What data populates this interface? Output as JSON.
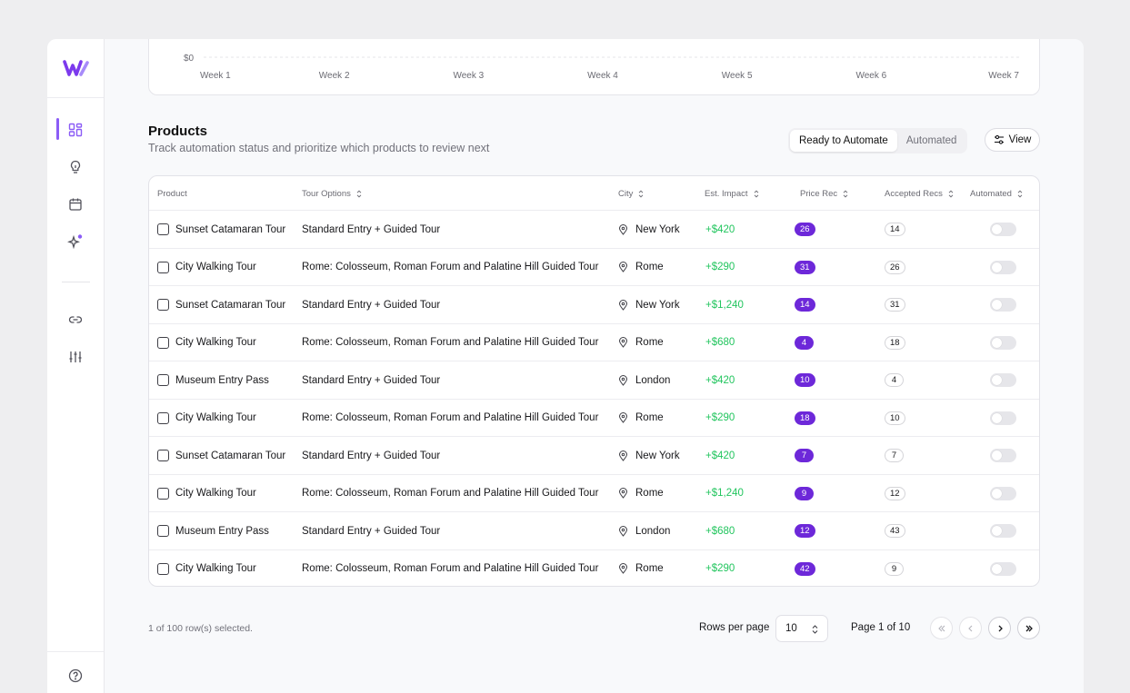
{
  "chart_data": {
    "type": "line",
    "categories": [
      "Week 1",
      "Week 2",
      "Week 3",
      "Week 4",
      "Week 5",
      "Week 6",
      "Week 7"
    ],
    "y_tick_visible": "$0",
    "grid": true
  },
  "sidebar": {
    "icons": [
      "logo-icon",
      "dashboard-icon",
      "lightbulb-icon",
      "calendar-icon",
      "sparkles-icon",
      "link-icon",
      "sliders-icon",
      "help-icon"
    ],
    "accent": "#8b5cf6"
  },
  "products": {
    "title": "Products",
    "subtitle": "Track automation status and prioritize which products to review next",
    "tabs": [
      {
        "label": "Ready to Automate",
        "active": true
      },
      {
        "label": "Automated",
        "active": false
      }
    ],
    "view_label": "View"
  },
  "table": {
    "headers": {
      "product": "Product",
      "tour_options": "Tour Options",
      "city": "City",
      "impact": "Est. Impact",
      "price_rec": "Price Rec",
      "accepted_recs": "Accepted Recs",
      "automated": "Automated"
    },
    "rows": [
      {
        "product": "Sunset Catamaran Tour",
        "option": "Standard Entry + Guided Tour",
        "city": "New York",
        "impact": "+$420",
        "price_rec": "26",
        "accepted": "14"
      },
      {
        "product": "City Walking Tour",
        "option": "Rome: Colosseum, Roman Forum and Palatine Hill Guided Tour",
        "city": "Rome",
        "impact": "+$290",
        "price_rec": "31",
        "accepted": "26"
      },
      {
        "product": "Sunset Catamaran Tour",
        "option": "Standard Entry + Guided Tour",
        "city": "New York",
        "impact": "+$1,240",
        "price_rec": "14",
        "accepted": "31"
      },
      {
        "product": "City Walking Tour",
        "option": "Rome: Colosseum, Roman Forum and Palatine Hill Guided Tour",
        "city": "Rome",
        "impact": "+$680",
        "price_rec": "4",
        "accepted": "18"
      },
      {
        "product": "Museum Entry Pass",
        "option": "Standard Entry + Guided Tour",
        "city": "London",
        "impact": "+$420",
        "price_rec": "10",
        "accepted": "4"
      },
      {
        "product": "City Walking Tour",
        "option": "Rome: Colosseum, Roman Forum and Palatine Hill Guided Tour",
        "city": "Rome",
        "impact": "+$290",
        "price_rec": "18",
        "accepted": "10"
      },
      {
        "product": "Sunset Catamaran Tour",
        "option": "Standard Entry + Guided Tour",
        "city": "New York",
        "impact": "+$420",
        "price_rec": "7",
        "accepted": "7"
      },
      {
        "product": "City Walking Tour",
        "option": "Rome: Colosseum, Roman Forum and Palatine Hill Guided Tour",
        "city": "Rome",
        "impact": "+$1,240",
        "price_rec": "9",
        "accepted": "12"
      },
      {
        "product": "Museum Entry Pass",
        "option": "Standard Entry + Guided Tour",
        "city": "London",
        "impact": "+$680",
        "price_rec": "12",
        "accepted": "43"
      },
      {
        "product": "City Walking Tour",
        "option": "Rome: Colosseum, Roman Forum and Palatine Hill Guided Tour",
        "city": "Rome",
        "impact": "+$290",
        "price_rec": "42",
        "accepted": "9"
      }
    ],
    "colors": {
      "impact": "#22c55e",
      "price_pill": "#6d28d9"
    }
  },
  "footer": {
    "selected_text": "1 of 100 row(s) selected.",
    "rows_per_page_label": "Rows per page",
    "rows_per_page_value": "10",
    "page_info": "Page 1 of 10"
  }
}
